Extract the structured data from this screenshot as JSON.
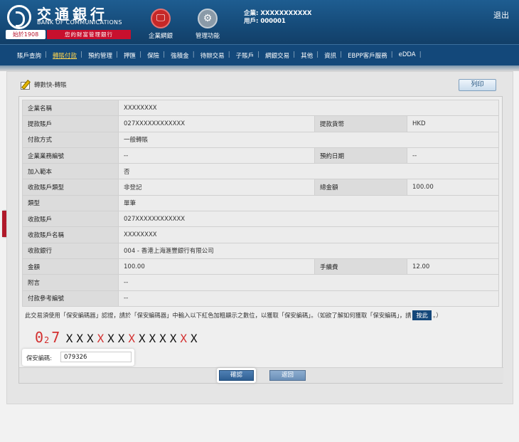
{
  "brand": {
    "name_cn": "交通銀行",
    "name_en": "BANK OF COMMUNICATIONS",
    "since": "始於1908",
    "slogan": "您的財富管理銀行"
  },
  "header_nav": [
    {
      "label": "企業網銀",
      "icon": "computer-icon"
    },
    {
      "label": "管理功能",
      "icon": "gear-icon"
    }
  ],
  "user": {
    "enterprise_line": "企業: XXXXXXXXXXX",
    "user_line": "用戶: 000001"
  },
  "logout_label": "退出",
  "menu": [
    {
      "label": "賬戶查詢",
      "active": false
    },
    {
      "label": "轉賬付款",
      "active": true
    },
    {
      "label": "預約管理",
      "active": false
    },
    {
      "label": "押匯",
      "active": false
    },
    {
      "label": "保險",
      "active": false
    },
    {
      "label": "強積金",
      "active": false
    },
    {
      "label": "待辦交易",
      "active": false
    },
    {
      "label": "子賬戶",
      "active": false
    },
    {
      "label": "網銀交易",
      "active": false
    },
    {
      "label": "其他",
      "active": false
    },
    {
      "label": "資訊",
      "active": false
    },
    {
      "label": "EBPP客戶服務",
      "active": false
    },
    {
      "label": "eDDA",
      "active": false
    }
  ],
  "page": {
    "title": "轉數快-轉賬",
    "print_label": "列印"
  },
  "details": {
    "company_name": {
      "label": "企業名稱",
      "value": "XXXXXXXX"
    },
    "debit_account": {
      "label": "提款賬戶",
      "value": "027XXXXXXXXXXXX"
    },
    "debit_currency": {
      "label": "提款貨幣",
      "value": "HKD"
    },
    "payment_method": {
      "label": "付款方式",
      "value": "一般轉賬"
    },
    "business_ref": {
      "label": "企業業務編號",
      "value": "--"
    },
    "scheduled_date": {
      "label": "預約日期",
      "value": "--"
    },
    "add_template": {
      "label": "加入範本",
      "value": "否"
    },
    "payee_account_type": {
      "label": "收款賬戶類型",
      "value": "非登記"
    },
    "total_amount": {
      "label": "總金額",
      "value": "100.00"
    },
    "type": {
      "label": "類型",
      "value": "單筆"
    },
    "payee_account": {
      "label": "收款賬戶",
      "value": "027XXXXXXXXXXXX"
    },
    "payee_name": {
      "label": "收款賬戶名稱",
      "value": "XXXXXXXX"
    },
    "payee_bank": {
      "label": "收款銀行",
      "value": "004 - 香港上海滙豐銀行有限公司"
    },
    "amount": {
      "label": "金額",
      "value": "100.00"
    },
    "fee": {
      "label": "手續費",
      "value": "12.00"
    },
    "remark": {
      "label": "附言",
      "value": "--"
    },
    "payment_ref": {
      "label": "付款參考編號",
      "value": "--"
    }
  },
  "security": {
    "hint_before": "此交易須使用「保安編碼器」認證，請於「保安編碼器」中輸入以下紅色加粗顯示之數位，以獲取「保安編碼」。（如欲了解如何獲取「保安編碼」，請",
    "hint_link": "按此",
    "hint_after": "。）",
    "seq_first": "0",
    "seq_sub": "2",
    "seq_second": "7",
    "seq_chars": [
      {
        "c": "X",
        "red": false
      },
      {
        "c": "X",
        "red": false
      },
      {
        "c": "X",
        "red": false
      },
      {
        "c": "X",
        "red": true
      },
      {
        "c": "X",
        "red": false
      },
      {
        "c": "X",
        "red": false
      },
      {
        "c": "X",
        "red": true
      },
      {
        "c": "X",
        "red": false
      },
      {
        "c": "X",
        "red": false
      },
      {
        "c": "X",
        "red": false
      },
      {
        "c": "X",
        "red": false
      },
      {
        "c": "X",
        "red": true
      },
      {
        "c": "X",
        "red": false
      }
    ],
    "code_label": "保安編碼:",
    "code_value": "079326"
  },
  "buttons": {
    "confirm": "確認",
    "back": "返回"
  },
  "colors": {
    "header": "#154a78",
    "menu": "#13487a",
    "accent_red": "#d32f2f",
    "active_menu": "#ffd54f"
  }
}
